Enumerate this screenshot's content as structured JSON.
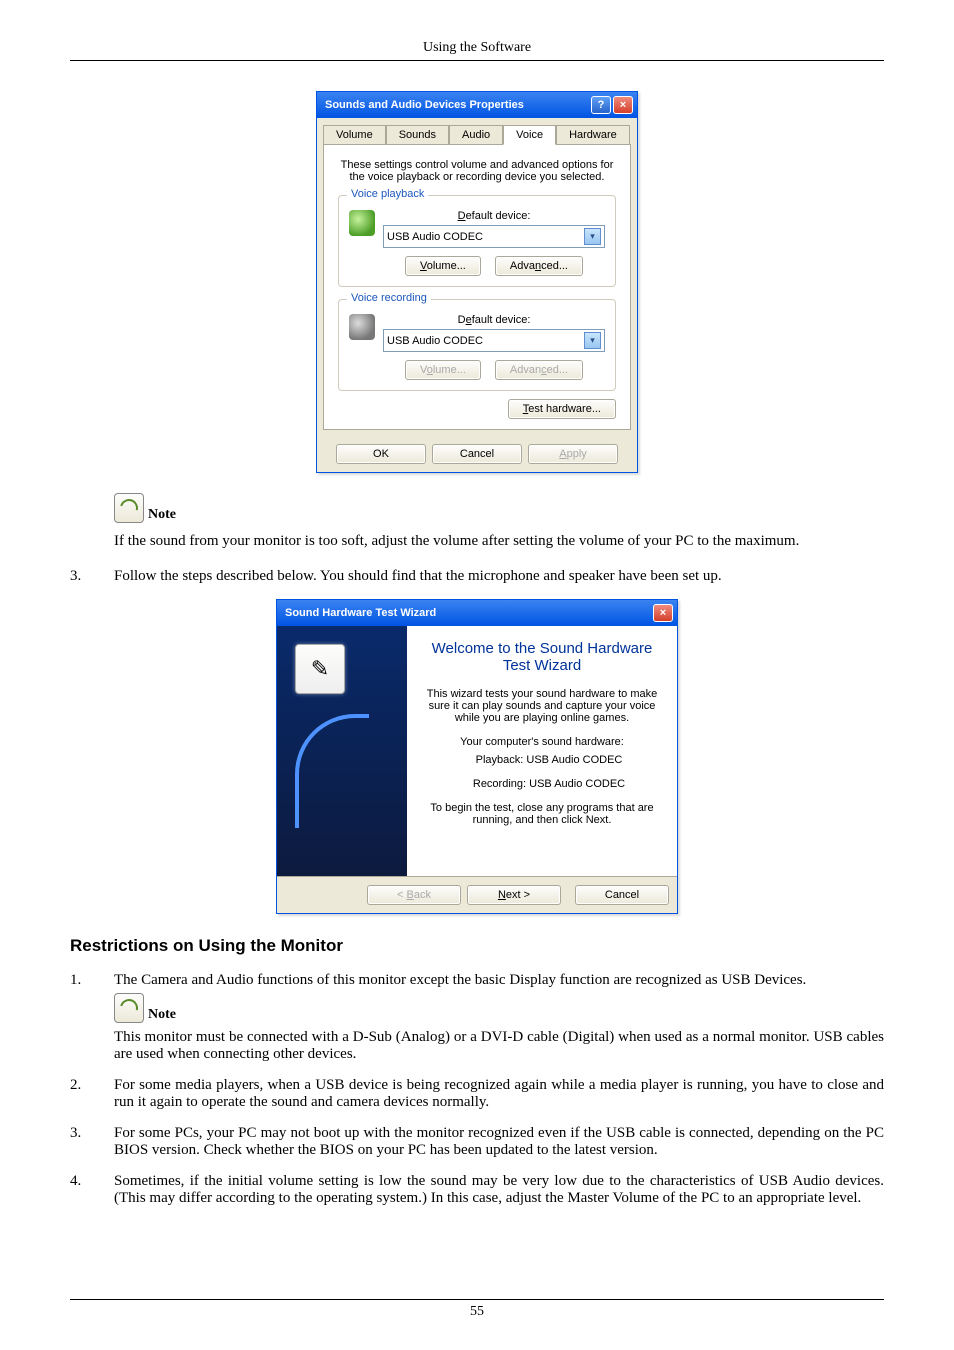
{
  "header": {
    "title": "Using the Software"
  },
  "footer": {
    "page": "55"
  },
  "dialog1": {
    "title": "Sounds and Audio Devices Properties",
    "help_glyph": "?",
    "close_glyph": "×",
    "tabs": {
      "volume": "Volume",
      "sounds": "Sounds",
      "audio": "Audio",
      "voice": "Voice",
      "hardware": "Hardware"
    },
    "desc": "These settings control volume and advanced options for the voice playback or recording device you selected.",
    "group_playback": {
      "legend": "Voice playback",
      "label_pre": "D",
      "label_post": "efault device:",
      "dropdown": "USB Audio CODEC",
      "btn_volume_pre": "V",
      "btn_volume_post": "olume...",
      "btn_adv_pre": "Adva",
      "btn_adv_u": "n",
      "btn_adv_post": "ced..."
    },
    "group_record": {
      "legend": "Voice recording",
      "label_pre": "D",
      "label_u": "e",
      "label_post": "fault device:",
      "dropdown": "USB Audio CODEC",
      "btn_volume_pre": "V",
      "btn_volume_u": "o",
      "btn_volume_post": "lume...",
      "btn_adv_pre": "Advan",
      "btn_adv_u": "c",
      "btn_adv_post": "ed..."
    },
    "test_btn_pre": "T",
    "test_btn_post": "est hardware...",
    "ok": "OK",
    "cancel": "Cancel",
    "apply_pre": "A",
    "apply_post": "pply"
  },
  "note1": {
    "label": "Note",
    "text": "If the sound from your monitor is too soft, adjust the volume after setting the volume of your PC to the maximum."
  },
  "step3": {
    "num": "3.",
    "text": "Follow the steps described below. You should find that the microphone and speaker have been set up."
  },
  "wizard": {
    "title": "Sound Hardware Test Wizard",
    "close_glyph": "×",
    "heading": "Welcome to the Sound Hardware Test Wizard",
    "para1": "This wizard tests your sound hardware to make sure it can play sounds and capture your voice while you are playing online games.",
    "para2": "Your computer's sound hardware:",
    "playback": "Playback:  USB Audio CODEC",
    "recording": "Recording:  USB Audio CODEC",
    "para3": "To begin the test, close any programs that are running, and then click Next.",
    "back_pre": "< ",
    "back_u": "B",
    "back_post": "ack",
    "next_pre": "N",
    "next_post": "ext >",
    "cancel": "Cancel"
  },
  "heading2": "Restrictions on Using the Monitor",
  "item1": {
    "num": "1.",
    "text": "The Camera and Audio functions of this monitor except the basic Display function are recognized as USB Devices."
  },
  "note2": {
    "label": "Note",
    "text": "This monitor must be connected with a D-Sub (Analog) or a DVI-D cable (Digital) when used as a normal monitor. USB cables are used when connecting other devices."
  },
  "item2": {
    "num": "2.",
    "text": "For some media players, when a USB device is being recognized again while a media player is running, you have to close and run it again to operate the sound and camera devices normally."
  },
  "item3": {
    "num": "3.",
    "text": "For some PCs, your PC may not boot up with the monitor recognized even if the USB cable is connected, depending on the PC BIOS version. Check whether the BIOS on your PC has been updated to the latest version."
  },
  "item4": {
    "num": "4.",
    "text": "Sometimes, if the initial volume setting is low the sound may be very low due to the characteristics of USB Audio devices. (This may differ according to the operating system.) In this case, adjust the Master Volume of the PC to an appropriate level."
  }
}
